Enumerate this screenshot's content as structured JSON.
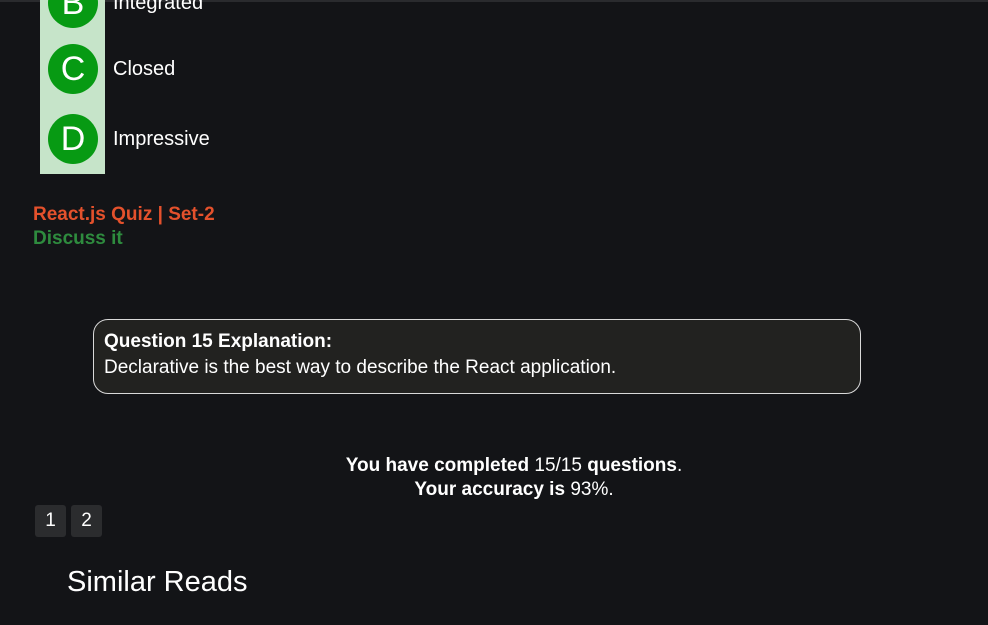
{
  "options": [
    {
      "letter": "B",
      "text": "Integrated"
    },
    {
      "letter": "C",
      "text": "Closed"
    },
    {
      "letter": "D",
      "text": "Impressive"
    }
  ],
  "quiz_link": "React.js Quiz | Set-2",
  "discuss_link": "Discuss it",
  "explanation": {
    "title": "Question 15 Explanation:",
    "body": "Declarative is the best way to describe the React application."
  },
  "summary": {
    "completed_prefix": "You have completed",
    "completed_value": "15/15",
    "completed_suffix": "questions",
    "accuracy_prefix": "Your accuracy is",
    "accuracy_value": "93%"
  },
  "pagination": [
    "1",
    "2"
  ],
  "similar_reads": "Similar Reads",
  "colors": {
    "background": "#131417",
    "option_badge": "#079a13",
    "option_strip": "#c6e4c9",
    "quiz_link": "#e4512c",
    "discuss_link": "#2e8b3e"
  }
}
